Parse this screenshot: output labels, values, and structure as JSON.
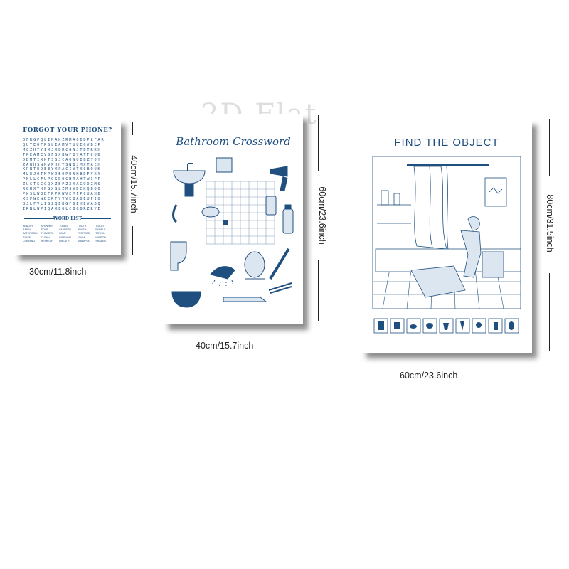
{
  "watermark": "2D Flat",
  "posters": {
    "word_search": {
      "title": "FORGOT YOUR PHONE?",
      "grid": "OFRGPQLINAKZRMAOIDPLFAR\nQUYEOFRSLIAMVYUUEQVBEP\nMCZHTYIXJXBRCGNJTBTRKH\nTPEAMEVSFSXBWFQYATFCUD\nDBMTIXKTSSJCAQNUIBZYOY\nZAWHSWMVPHHTSNBJMXTAEH\nKPNTEDEEYXPACIVTXCBOUK\nMLEJOTMPWDEOPUNHBDFYXY\nPNLLCFUPGSDOCHRAHTWIPP\nZUSTSCQQXZBPZXXAGUDZMS\nRGHXYKNGXSLZMSVDCKQBOO\nPWSLWODFRPRWVEMFPCUAHB\nXSPWEWDCRFYVVEBADEUFIO\nBJLFVLIGZQEBGFGEHEVABQ\nIRNLWPIQAXEOLCBGBRZRYE",
      "word_list_title": "WORD LIST",
      "words": [
        "BEAUTY",
        "SHOWER",
        "TOWEL",
        "TOOTH",
        "TOILET",
        "BASIN",
        "SOAP",
        "LAUNDRY",
        "BRUSH",
        "BUBBLE",
        "BATHROOM",
        "FLOWERS",
        "LOVE",
        "PERFUME",
        "TOWEL",
        "RINSE",
        "CLEAN",
        "WASHING",
        "FOAM",
        "MIRROR",
        "COMBING",
        "REFRESH",
        "BREATH",
        "SHAMPOO",
        "SHAVER"
      ]
    },
    "crossword": {
      "title": "Bathroom Crossword"
    },
    "find_object": {
      "title": "FIND THE OBJECT"
    }
  },
  "dimensions": {
    "p1_width": "30cm/11.8inch",
    "p1_height": "40cm/15.7inch",
    "p2_width": "40cm/15.7inch",
    "p2_height": "60cm/23.6inch",
    "p3_width": "60cm/23.6inch",
    "p3_height": "80cm/31.5inch"
  },
  "colors": {
    "ink": "#1f4f7f",
    "shadow": "#000000"
  }
}
